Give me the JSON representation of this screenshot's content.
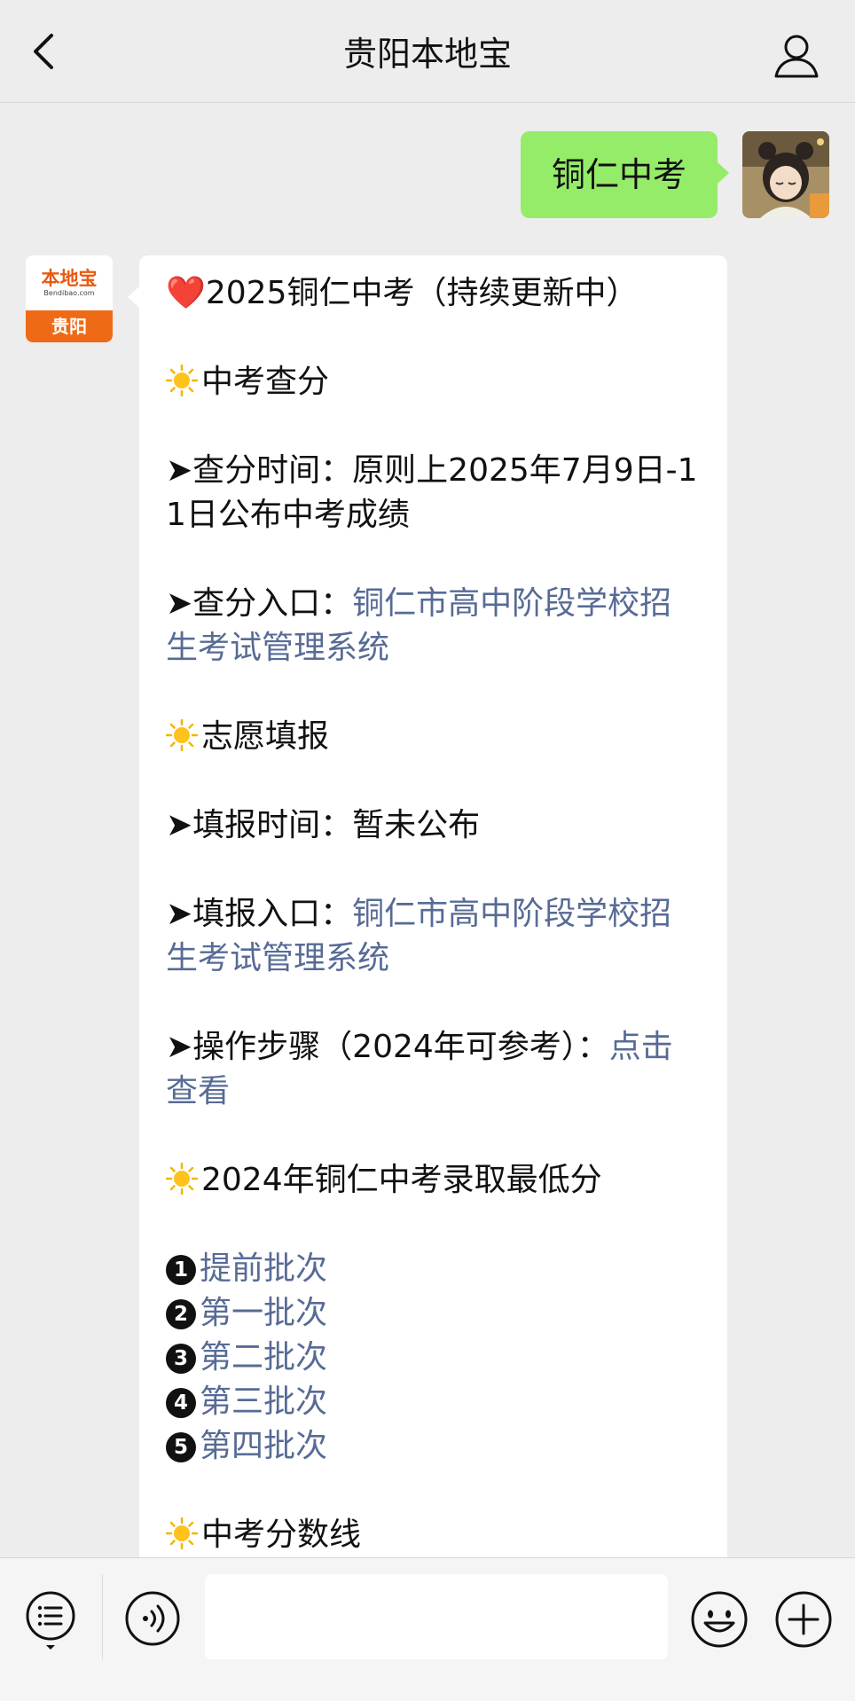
{
  "header": {
    "title": "贵阳本地宝",
    "back_icon": "chevron-left-icon",
    "profile_icon": "person-icon"
  },
  "outgoing": {
    "text": "铜仁中考",
    "bubble_color": "#95ec69"
  },
  "bot": {
    "avatar_logo_text": "本地宝",
    "avatar_logo_sub": "Bendibao.com",
    "avatar_city": "贵阳"
  },
  "message": {
    "title": "2025铜仁中考（持续更新中）",
    "heart": "❤️",
    "section_score": "中考查分",
    "score_time_prefix": "➤查分时间：",
    "score_time_value": "原则上2025年7月9日-11日公布中考成绩",
    "score_entry_prefix": "➤查分入口：",
    "score_entry_link": "铜仁市高中阶段学校招生考试管理系统",
    "section_apply": "志愿填报",
    "apply_time_prefix": "➤填报时间：",
    "apply_time_value": "暂未公布",
    "apply_entry_prefix": "➤填报入口：",
    "apply_entry_link": "铜仁市高中阶段学校招生考试管理系统",
    "steps_prefix": "➤操作步骤（2024年可参考）：",
    "steps_link": "点击查看",
    "section_min_score": "2024年铜仁中考录取最低分",
    "batches": [
      {
        "num": "1",
        "label": "提前批次"
      },
      {
        "num": "2",
        "label": "第一批次"
      },
      {
        "num": "3",
        "label": "第二批次"
      },
      {
        "num": "4",
        "label": "第三批次"
      },
      {
        "num": "5",
        "label": "第四批次"
      }
    ],
    "section_cutoff": "中考分数线",
    "link_color": "#576b95"
  },
  "input_bar": {
    "menu_icon": "list-menu-icon",
    "voice_icon": "voice-icon",
    "input_value": "",
    "emoji_icon": "emoji-icon",
    "plus_icon": "plus-icon"
  }
}
